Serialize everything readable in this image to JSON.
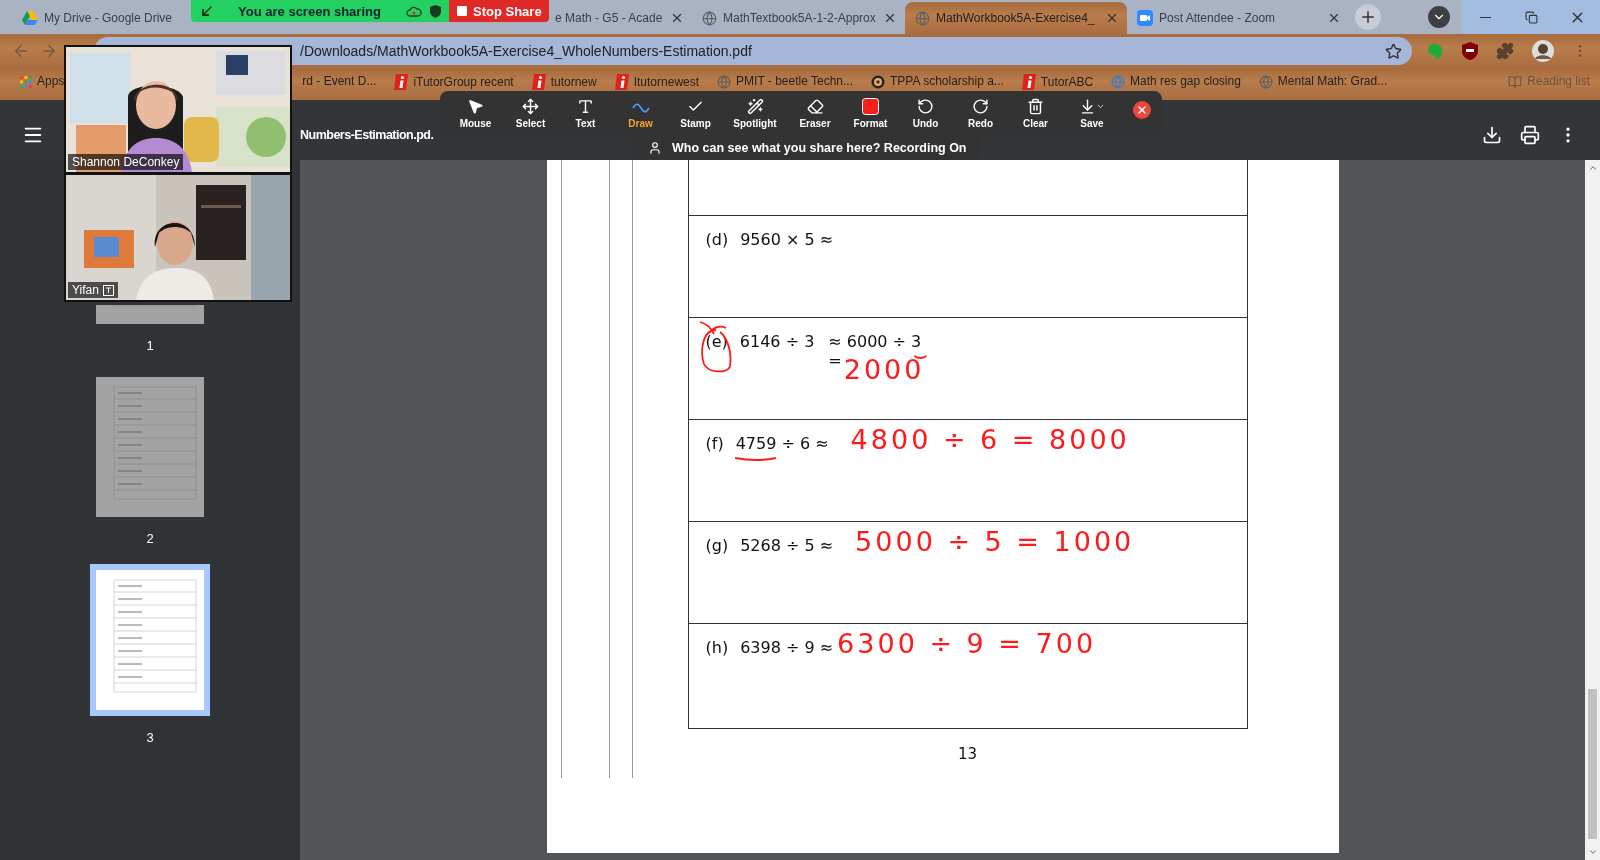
{
  "tabs": [
    {
      "title": "My Drive - Google Drive",
      "kind": "drive",
      "selected": false,
      "closable": false
    },
    {
      "title": "e Math - G5 - Acade",
      "kind": "covered",
      "selected": false,
      "closable": true
    },
    {
      "title": "MathTextbook5A-1-2-Approx",
      "kind": "globe",
      "selected": false,
      "closable": true
    },
    {
      "title": "MathWorkbook5A-Exercise4_",
      "kind": "globe",
      "selected": true,
      "closable": true
    },
    {
      "title": "Post Attendee - Zoom",
      "kind": "zoom",
      "selected": false,
      "closable": true
    }
  ],
  "share_banner": {
    "text": "You are screen sharing",
    "stop": "Stop Share"
  },
  "address_bar": {
    "url": "/Downloads/MathWorkbook5A-Exercise4_WholeNumbers-Estimation.pdf"
  },
  "bookmarks": [
    {
      "label": "Apps",
      "kind": "apps"
    },
    {
      "label": "rd - Event D...",
      "kind": "covered"
    },
    {
      "label": "iTutorGroup recent",
      "kind": "itutor"
    },
    {
      "label": "tutornew",
      "kind": "itutor"
    },
    {
      "label": "Itutornewest",
      "kind": "itutor"
    },
    {
      "label": "PMIT - beetle Techn...",
      "kind": "globe"
    },
    {
      "label": "TPPA scholarship a...",
      "kind": "emblem"
    },
    {
      "label": "TutorABC",
      "kind": "itutor"
    },
    {
      "label": "Math res gap closing",
      "kind": "web"
    },
    {
      "label": "Mental Math: Grad...",
      "kind": "globe"
    },
    {
      "label": "Reading list",
      "kind": "reading"
    }
  ],
  "viewer": {
    "title": "Numbers-Estimation.pd."
  },
  "annotation_toolbar": {
    "tools": [
      {
        "label": "Mouse",
        "kind": "mouse",
        "selected": false
      },
      {
        "label": "Select",
        "kind": "select",
        "selected": false
      },
      {
        "label": "Text",
        "kind": "text",
        "selected": false
      },
      {
        "label": "Draw",
        "kind": "draw",
        "selected": true
      },
      {
        "label": "Stamp",
        "kind": "stamp",
        "selected": false
      },
      {
        "label": "Spotlight",
        "kind": "spotlight",
        "selected": false
      },
      {
        "label": "Eraser",
        "kind": "eraser",
        "selected": false
      },
      {
        "label": "Format",
        "kind": "format",
        "selected": false
      },
      {
        "label": "Undo",
        "kind": "undo",
        "selected": false
      },
      {
        "label": "Redo",
        "kind": "redo",
        "selected": false
      },
      {
        "label": "Clear",
        "kind": "clear",
        "selected": false
      },
      {
        "label": "Save",
        "kind": "save",
        "selected": false
      }
    ]
  },
  "share_notice": "Who can see what you share here? Recording On",
  "video_tiles": [
    {
      "name": "Shannon DeConkey",
      "kind": "teacher"
    },
    {
      "name": "Yifan",
      "kind": "student"
    }
  ],
  "thumbnails": [
    {
      "label": "1",
      "selected": false
    },
    {
      "label": "2",
      "selected": false
    },
    {
      "label": "3",
      "selected": true
    }
  ],
  "page": {
    "rows": [
      {
        "label": "(d)",
        "expression": "9560 × 5 ≈",
        "circled": false,
        "underline_first_number": false
      },
      {
        "label": "(e)",
        "expression": "6146 ÷ 3",
        "circled": true,
        "underline_first_number": false,
        "typed": "≈ 6000 ÷ 3",
        "underline_last_number": true,
        "equals": "=",
        "handwriting": "2000"
      },
      {
        "label": "(f)",
        "expression": "4759 ÷ 6 ≈",
        "circled": false,
        "underline_first_number": true,
        "handwriting": "4800 ÷ 6 = 8000"
      },
      {
        "label": "(g)",
        "expression": "5268 ÷ 5 ≈",
        "circled": false,
        "underline_first_number": false,
        "handwriting": "5000 ÷ 5 = 1000"
      },
      {
        "label": "(h)",
        "expression": "6398 ÷ 9 ≈",
        "circled": false,
        "underline_first_number": false,
        "handwriting": "6300 ÷ 9 = 700"
      }
    ],
    "page_number": "13"
  }
}
